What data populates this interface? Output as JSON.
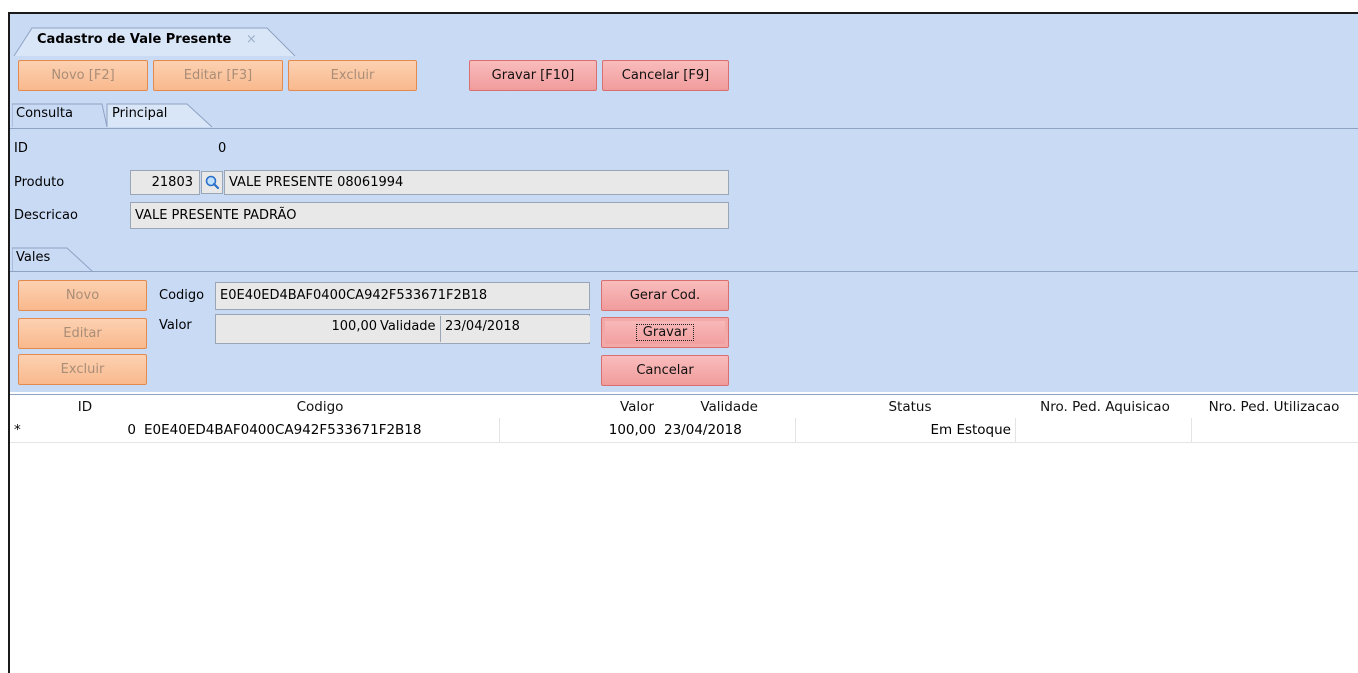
{
  "window": {
    "tab_title": "Cadastro de Vale Presente",
    "tab_close": "×"
  },
  "toolbar": {
    "novo": "Novo [F2]",
    "editar": "Editar [F3]",
    "excluir": "Excluir",
    "gravar": "Gravar [F10]",
    "cancelar": "Cancelar [F9]"
  },
  "tabs": {
    "consulta": "Consulta",
    "principal": "Principal"
  },
  "form": {
    "id_label": "ID",
    "id_value": "0",
    "produto_label": "Produto",
    "produto_code": "21803",
    "produto_name": "VALE PRESENTE 08061994",
    "descricao_label": "Descricao",
    "descricao_value": "VALE PRESENTE PADRÃO"
  },
  "vales": {
    "tab_label": "Vales",
    "novo": "Novo",
    "editar": "Editar",
    "excluir": "Excluir",
    "codigo_label": "Codigo",
    "codigo_value": "E0E40ED4BAF0400CA942F533671F2B18",
    "valor_label": "Valor",
    "valor_value": "100,00",
    "validade_label": "Validade",
    "validade_value": "23/04/2018",
    "gerar_cod": "Gerar Cod.",
    "gravar": "Gravar",
    "cancelar": "Cancelar"
  },
  "grid": {
    "columns": [
      "ID",
      "Codigo",
      "Valor",
      "Validade",
      "Status",
      "Nro. Ped. Aquisicao",
      "Nro. Ped. Utilizacao"
    ],
    "rows": [
      {
        "indicator": "*",
        "id": "0",
        "codigo": "E0E40ED4BAF0400CA942F533671F2B18",
        "valor": "100,00",
        "validade": "23/04/2018",
        "status": "Em Estoque",
        "aquisicao": "",
        "utilizacao": ""
      }
    ]
  },
  "colors": {
    "band": "#c9daf5",
    "orange_button": "#f9b98d",
    "red_button": "#f19c9c"
  }
}
